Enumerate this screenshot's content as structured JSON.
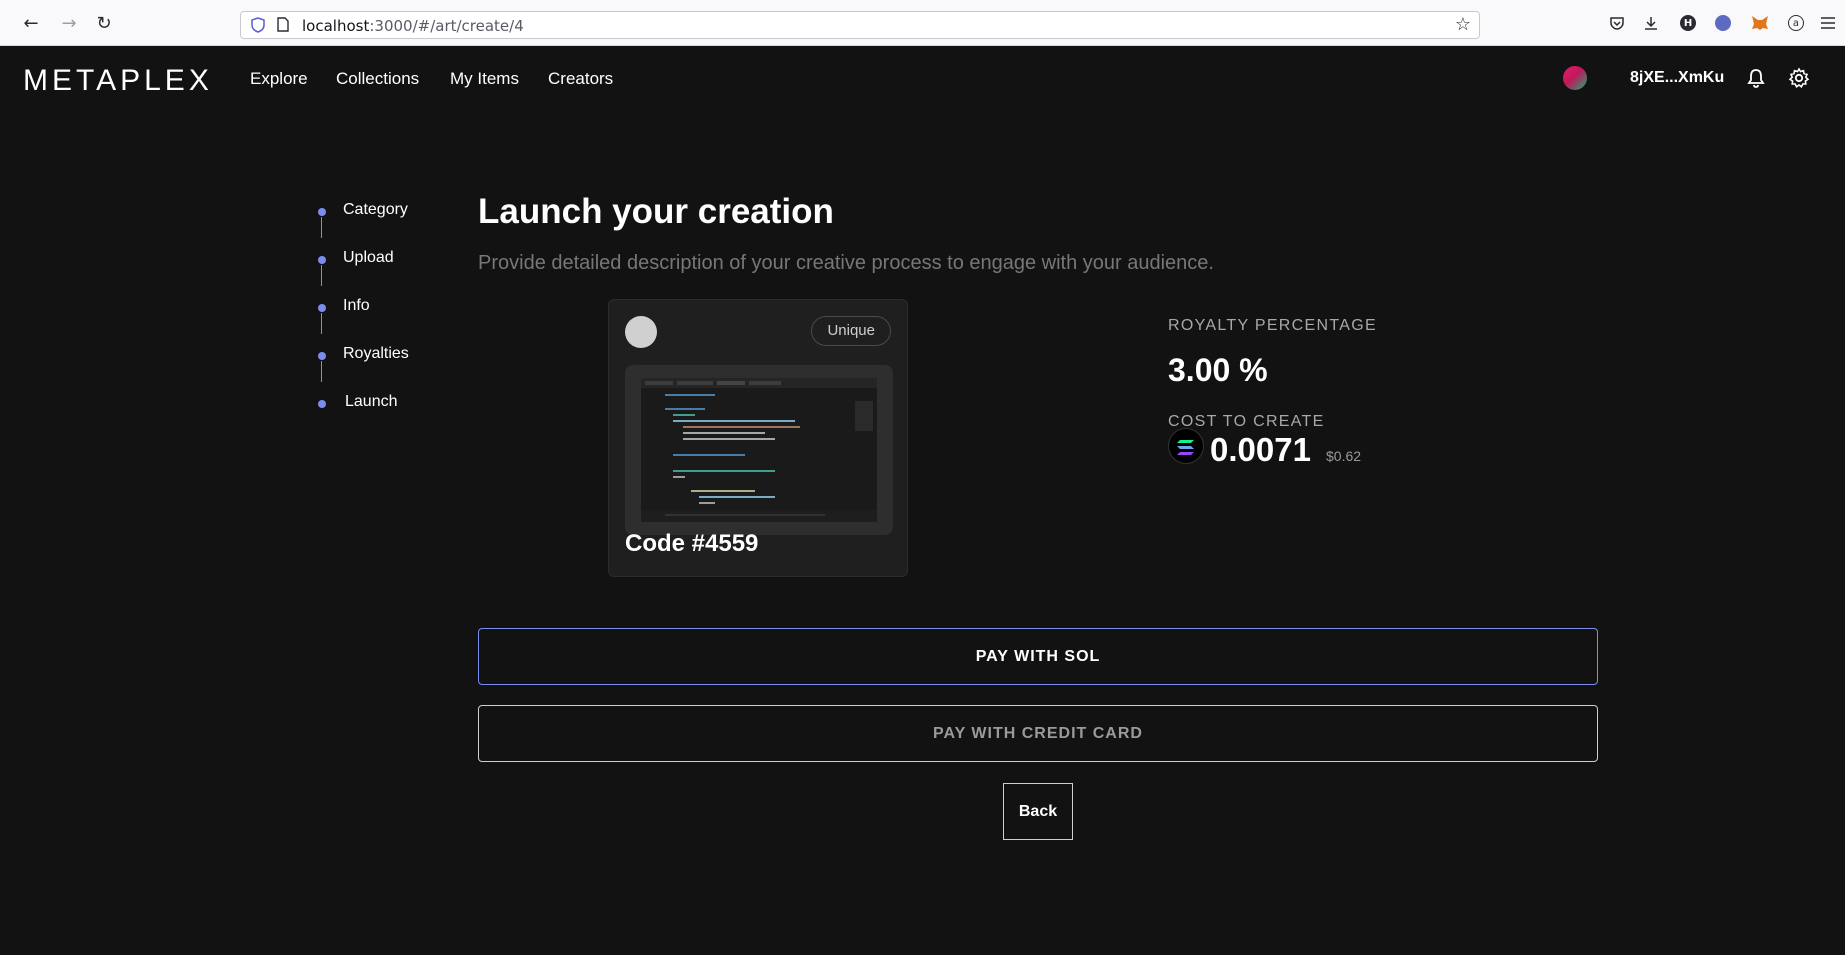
{
  "browser": {
    "url_host": "localhost",
    "url_path": ":3000/#/art/create/4"
  },
  "header": {
    "logo": "METAPLEX",
    "nav": [
      "Explore",
      "Collections",
      "My Items",
      "Creators"
    ],
    "wallet_address": "8jXE...XmKu"
  },
  "stepper": {
    "steps": [
      "Category",
      "Upload",
      "Info",
      "Royalties",
      "Launch"
    ]
  },
  "main": {
    "title": "Launch your creation",
    "subtitle": "Provide detailed description of your creative process to engage with your audience."
  },
  "card": {
    "badge": "Unique",
    "title": "Code #4559"
  },
  "summary": {
    "royalty_label": "ROYALTY PERCENTAGE",
    "royalty_value": "3.00 %",
    "cost_label": "COST TO CREATE",
    "cost_value": "0.0071",
    "cost_usd": "$0.62"
  },
  "actions": {
    "pay_sol": "PAY WITH SOL",
    "pay_card": "PAY WITH CREDIT CARD",
    "back": "Back"
  },
  "colors": {
    "accent": "#7b8cf0",
    "background": "#121212",
    "card": "#1f1f1f"
  }
}
